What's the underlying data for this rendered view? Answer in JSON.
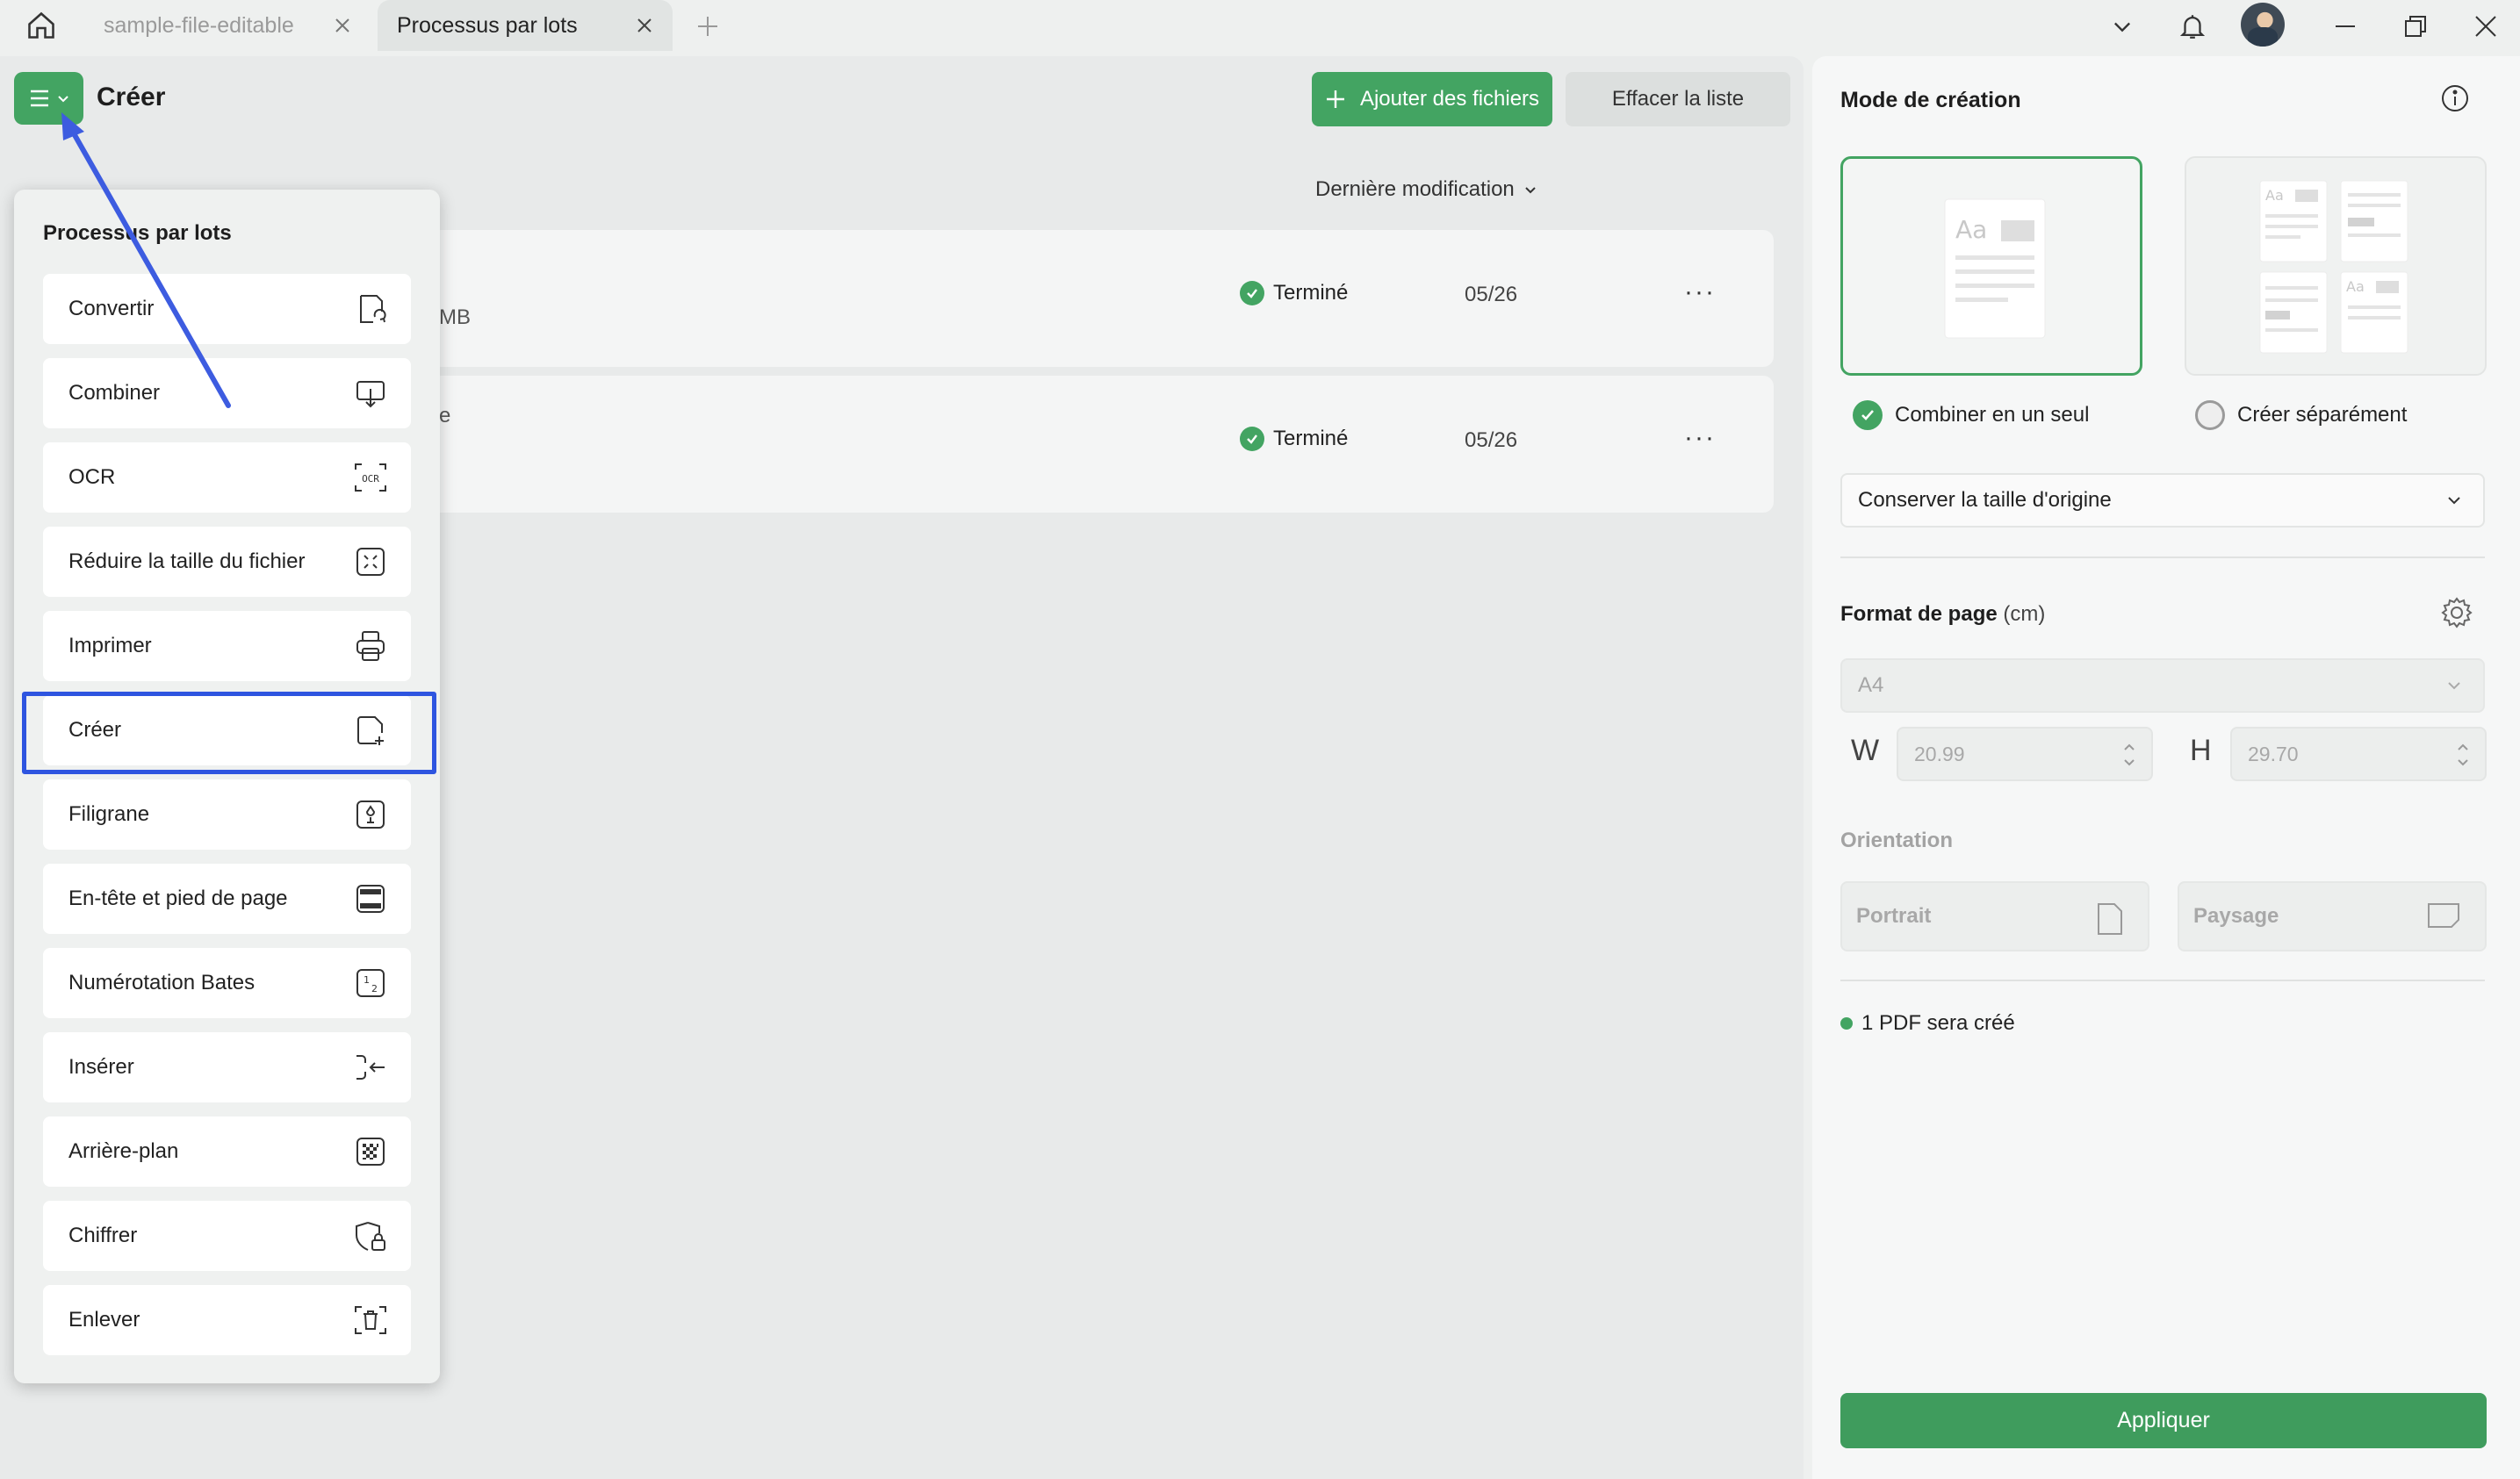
{
  "tabs": [
    {
      "label": "sample-file-editable",
      "active": false
    },
    {
      "label": "Processus par lots",
      "active": true
    }
  ],
  "icons": {
    "home": "home-icon",
    "close": "close-icon",
    "add_tab": "plus-icon",
    "dropdown": "chevron-down-icon",
    "notifications": "bell-icon",
    "minimize": "minimize-icon",
    "restore": "restore-icon",
    "window_close": "close-icon"
  },
  "header": {
    "title": "Créer",
    "add_files_label": "Ajouter des fichiers",
    "clear_list_label": "Effacer la liste",
    "sort_label": "Dernière modification"
  },
  "files": [
    {
      "name_fragment": "",
      "size_fragment": "MB",
      "status": "Terminé",
      "date": "05/26",
      "more": "···"
    },
    {
      "name_fragment": "e",
      "size_fragment": "",
      "status": "Terminé",
      "date": "05/26",
      "more": "···"
    }
  ],
  "menu": {
    "title": "Processus par lots",
    "items": [
      {
        "label": "Convertir",
        "icon": "convert-icon"
      },
      {
        "label": "Combiner",
        "icon": "combine-icon"
      },
      {
        "label": "OCR",
        "icon": "ocr-icon"
      },
      {
        "label": "Réduire la taille du fichier",
        "icon": "compress-icon"
      },
      {
        "label": "Imprimer",
        "icon": "printer-icon"
      },
      {
        "label": "Créer",
        "icon": "create-icon",
        "highlighted": true
      },
      {
        "label": "Filigrane",
        "icon": "watermark-icon"
      },
      {
        "label": "En-tête et pied de page",
        "icon": "header-footer-icon"
      },
      {
        "label": "Numérotation Bates",
        "icon": "bates-icon"
      },
      {
        "label": "Insérer",
        "icon": "insert-icon"
      },
      {
        "label": "Arrière-plan",
        "icon": "background-icon"
      },
      {
        "label": "Chiffrer",
        "icon": "encrypt-icon"
      },
      {
        "label": "Enlever",
        "icon": "remove-icon"
      }
    ]
  },
  "settings": {
    "creation_mode_title": "Mode de création",
    "combine_label": "Combiner en un seul",
    "separate_label": "Créer séparément",
    "selected_mode": "combine",
    "size_option": "Conserver la taille d'origine",
    "page_format_title": "Format de page",
    "page_format_unit": "(cm)",
    "paper": "A4",
    "width_label": "W",
    "width_value": "20.99",
    "height_label": "H",
    "height_value": "29.70",
    "orientation_title": "Orientation",
    "portrait_label": "Portrait",
    "landscape_label": "Paysage",
    "pdf_note": "1 PDF sera créé",
    "apply_label": "Appliquer",
    "thumb_text": "Aa"
  },
  "colors": {
    "accent": "#43a462",
    "highlight_box": "#2e55e0",
    "annotation_arrow": "#3d5ce0"
  }
}
